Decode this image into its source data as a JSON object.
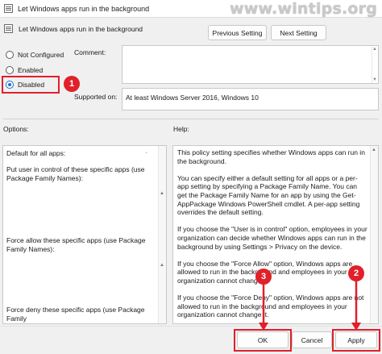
{
  "window": {
    "title": "Let Windows apps run in the background"
  },
  "watermark": "www.wintips.org",
  "header": {
    "setting_name": "Let Windows apps run in the background",
    "prev_label": "Previous Setting",
    "next_label": "Next Setting"
  },
  "state": {
    "options": [
      "Not Configured",
      "Enabled",
      "Disabled"
    ],
    "selected": "Disabled"
  },
  "comment": {
    "label": "Comment:",
    "value": ""
  },
  "supported": {
    "label": "Supported on:",
    "value": "At least Windows Server 2016, Windows 10"
  },
  "options_section": {
    "label": "Options:",
    "default_label": "Default for all apps:",
    "put_user_label": "Put user in control of these specific apps (use Package Family Names):",
    "force_allow_label": "Force allow these specific apps (use Package Family Names):",
    "force_deny_label": "Force deny these specific apps (use Package Family"
  },
  "help": {
    "label": "Help:",
    "paragraphs": [
      "This policy setting specifies whether Windows apps can run in the background.",
      "You can specify either a default setting for all apps or a per-app setting by specifying a Package Family Name. You can get the Package Family Name for an app by using the Get-AppPackage Windows PowerShell cmdlet. A per-app setting overrides the default setting.",
      "If you choose the \"User is in control\" option, employees in your organization can decide whether Windows apps can run in the background by using Settings > Privacy on the device.",
      "If you choose the \"Force Allow\" option, Windows apps are allowed to run in the background and employees in your organization cannot change it.",
      "If you choose the \"Force Deny\" option, Windows apps are not allowed to run in the background and employees in your organization cannot change it."
    ]
  },
  "footer": {
    "ok_label": "OK",
    "cancel_label": "Cancel",
    "apply_label": "Apply"
  },
  "annotations": {
    "step1": "1",
    "step2": "2",
    "step3": "3"
  },
  "colors": {
    "accent": "#1a6fd0",
    "annotation": "#e0202a"
  }
}
